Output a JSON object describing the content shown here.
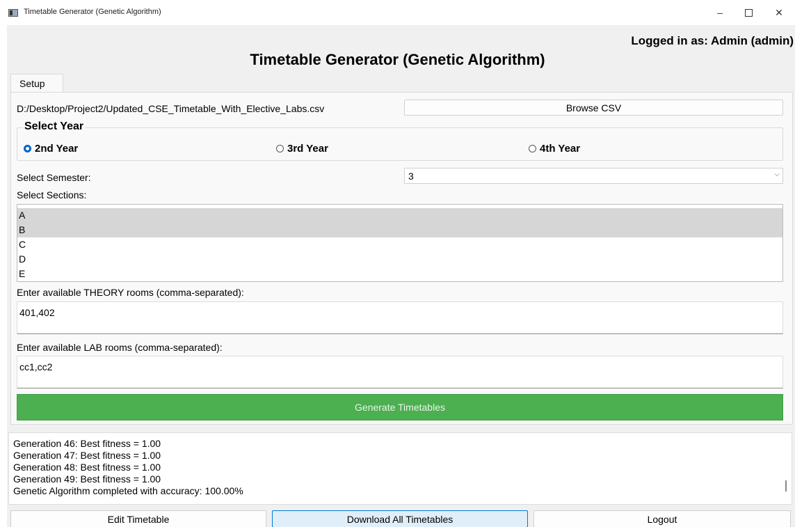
{
  "window": {
    "title": "Timetable Generator (Genetic Algorithm)",
    "minimize_glyph": "–",
    "close_glyph": "✕"
  },
  "header": {
    "logged_in": "Logged in as: Admin (admin)",
    "title": "Timetable Generator (Genetic Algorithm)"
  },
  "tabs": [
    "Setup"
  ],
  "setup": {
    "csv_path": "D:/Desktop/Project2/Updated_CSE_Timetable_With_Elective_Labs.csv",
    "browse_label": "Browse CSV",
    "year_group_label": "Select Year",
    "years": [
      {
        "label": "2nd Year",
        "selected": true
      },
      {
        "label": "3rd Year",
        "selected": false
      },
      {
        "label": "4th Year",
        "selected": false
      }
    ],
    "semester_label": "Select Semester:",
    "semester_value": "3",
    "sections_label": "Select Sections:",
    "sections": [
      {
        "label": "A",
        "selected": true
      },
      {
        "label": "B",
        "selected": true
      },
      {
        "label": "C",
        "selected": false
      },
      {
        "label": "D",
        "selected": false
      },
      {
        "label": "E",
        "selected": false
      }
    ],
    "theory_label": "Enter available THEORY rooms (comma-separated):",
    "theory_value": "401,402",
    "lab_label": "Enter available LAB rooms (comma-separated):",
    "lab_value": "cc1,cc2",
    "generate_label": "Generate Timetables"
  },
  "log": [
    "Generation 46: Best fitness = 1.00",
    "Generation 47: Best fitness = 1.00",
    "Generation 48: Best fitness = 1.00",
    "Generation 49: Best fitness = 1.00",
    "Genetic Algorithm completed with accuracy: 100.00%"
  ],
  "footer": {
    "edit_label": "Edit Timetable",
    "download_label": "Download All Timetables",
    "logout_label": "Logout"
  },
  "colors": {
    "generate_button": "#4caf50",
    "radio_selected": "#0064c8",
    "focused_button_border": "#0078d4"
  }
}
